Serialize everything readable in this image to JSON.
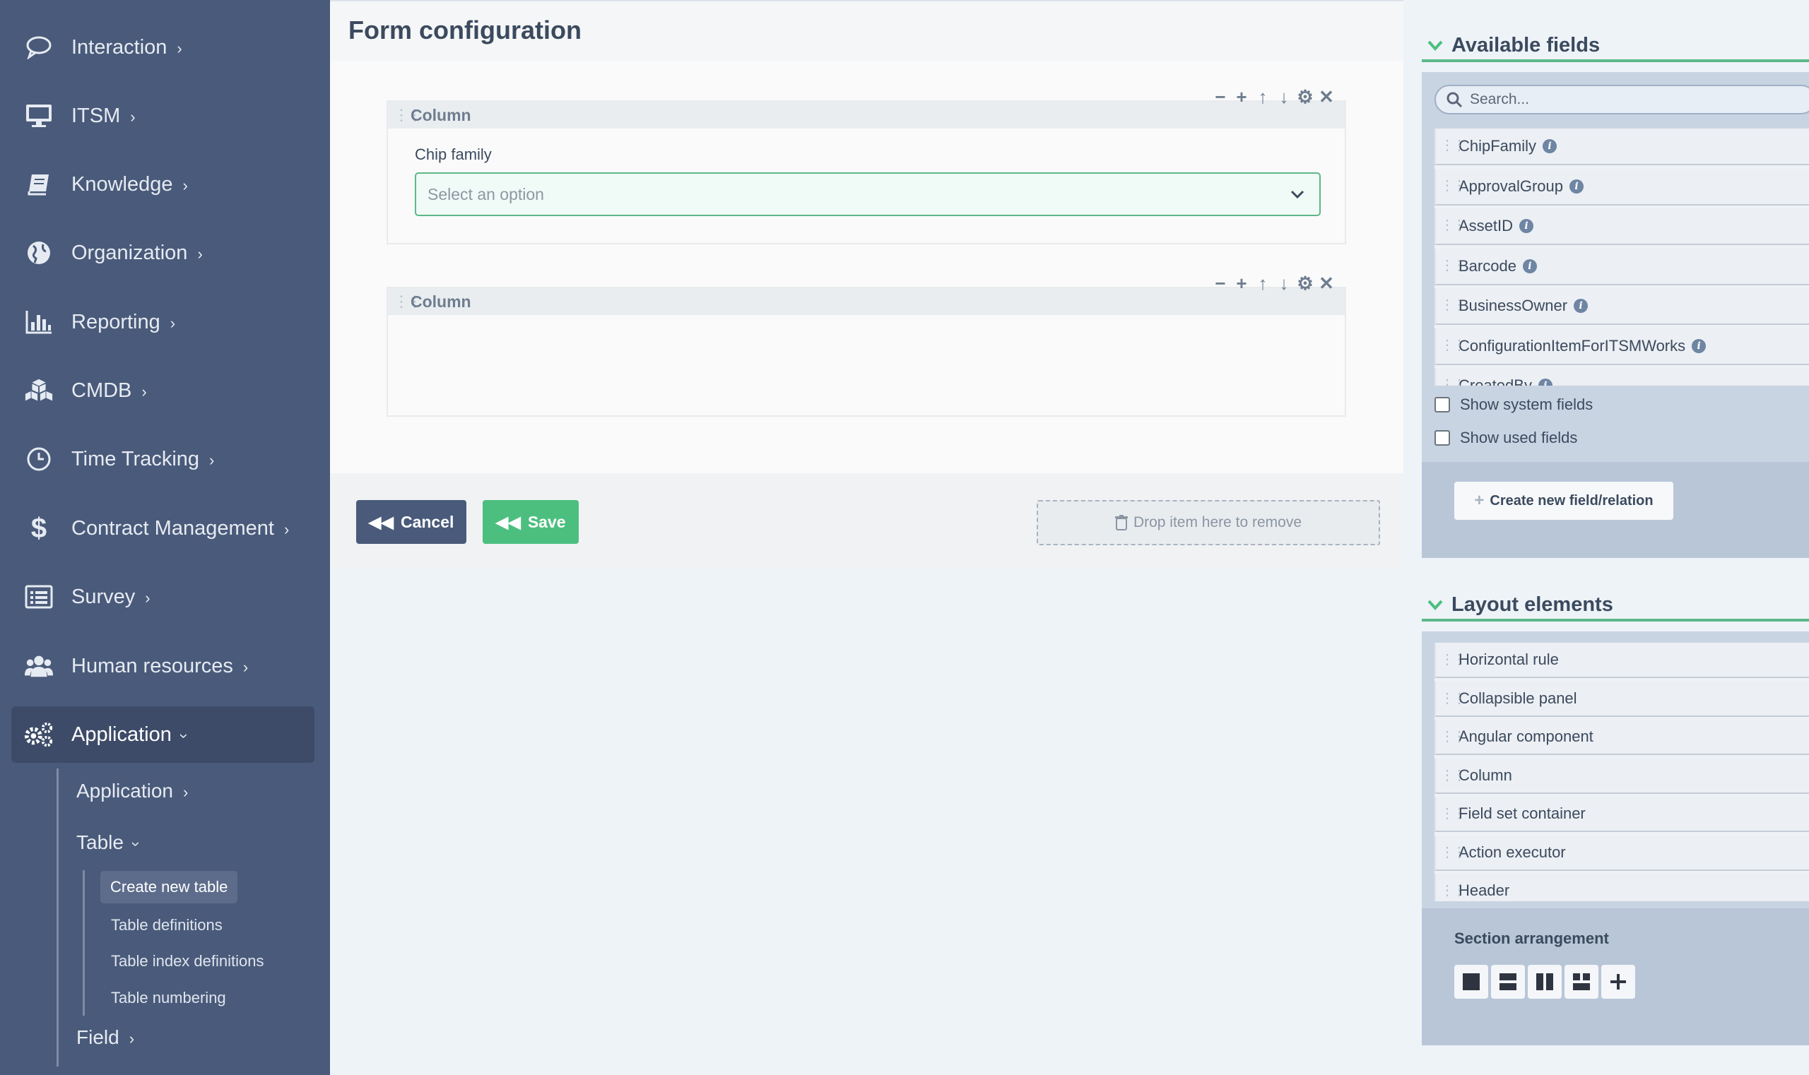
{
  "sidebar": {
    "items": [
      {
        "label": "Interaction",
        "icon": "chat-bubble-icon"
      },
      {
        "label": "ITSM",
        "icon": "monitor-icon"
      },
      {
        "label": "Knowledge",
        "icon": "book-icon"
      },
      {
        "label": "Organization",
        "icon": "globe-icon"
      },
      {
        "label": "Reporting",
        "icon": "bar-chart-icon"
      },
      {
        "label": "CMDB",
        "icon": "cubes-icon"
      },
      {
        "label": "Time Tracking",
        "icon": "clock-icon"
      },
      {
        "label": "Contract Management",
        "icon": "dollar-icon"
      },
      {
        "label": "Survey",
        "icon": "list-icon"
      },
      {
        "label": "Human resources",
        "icon": "users-icon"
      },
      {
        "label": "Application",
        "icon": "gears-icon"
      }
    ],
    "sub": {
      "application": "Application",
      "table": "Table",
      "table_children": [
        "Create new table",
        "Table definitions",
        "Table index definitions",
        "Table numbering"
      ],
      "field": "Field"
    }
  },
  "main": {
    "title": "Form configuration",
    "columns": [
      {
        "title": "Column",
        "field_label": "Chip family",
        "placeholder": "Select an option"
      },
      {
        "title": "Column"
      }
    ],
    "tools": [
      "−",
      "+",
      "↑",
      "↓",
      "⚙",
      "✕"
    ],
    "buttons": {
      "cancel": "Cancel",
      "save": "Save"
    },
    "drop_zone": "Drop item here to remove"
  },
  "available_fields": {
    "title": "Available fields",
    "search_placeholder": "Search...",
    "items": [
      "ChipFamily",
      "ApprovalGroup",
      "AssetID",
      "Barcode",
      "BusinessOwner",
      "ConfigurationItemForITSMWorks",
      "CreatedBy"
    ],
    "show_system_fields": "Show system fields",
    "show_used_fields": "Show used fields",
    "create_button": "Create new field/relation"
  },
  "layout_elements": {
    "title": "Layout elements",
    "items": [
      "Horizontal rule",
      "Collapsible panel",
      "Angular component",
      "Column",
      "Field set container",
      "Action executor",
      "Header"
    ],
    "section_arrangement": "Section arrangement"
  },
  "colors": {
    "sidebar_bg": "#4a5a7a",
    "accent_green": "#4cbf7f",
    "cancel_bg": "#4a5a7a"
  }
}
